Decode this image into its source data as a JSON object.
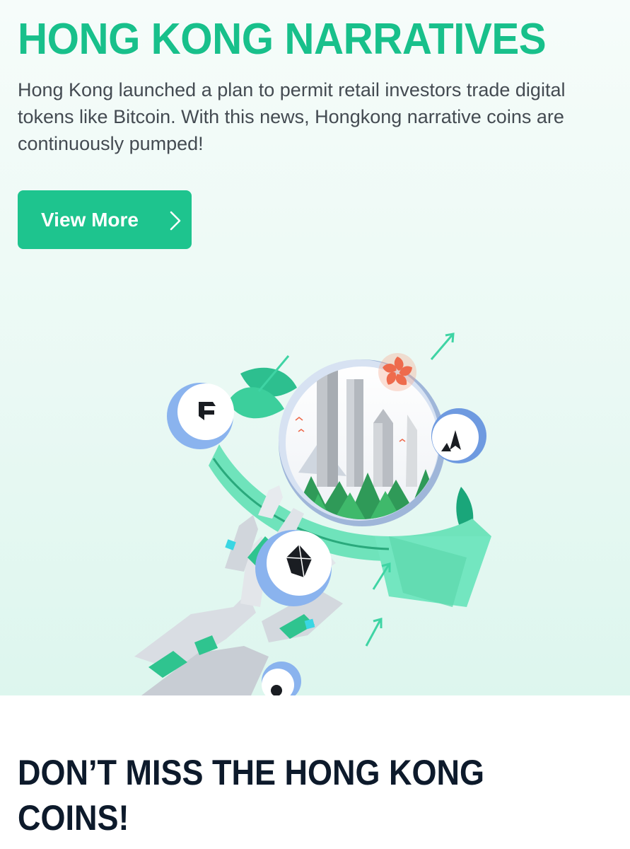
{
  "hero": {
    "title": "HONG KONG NARRATIVES",
    "description": "Hong Kong launched a plan to permit retail investors trade digital tokens like Bitcoin. With this news, Hongkong narrative coins are continuously pumped!",
    "cta_label": "View More",
    "cta_icon": "chevron-right-icon",
    "illustration_icon": "robot-hand-holding-hong-kong-globe"
  },
  "section": {
    "title": "DON’T MISS THE HONG KONG COINS!"
  },
  "colors": {
    "accent": "#1ec48e",
    "title_green": "#18c08b",
    "heading_dark": "#0d1a2b",
    "body_text": "#444b52",
    "hero_background": "#eaf9f4"
  }
}
